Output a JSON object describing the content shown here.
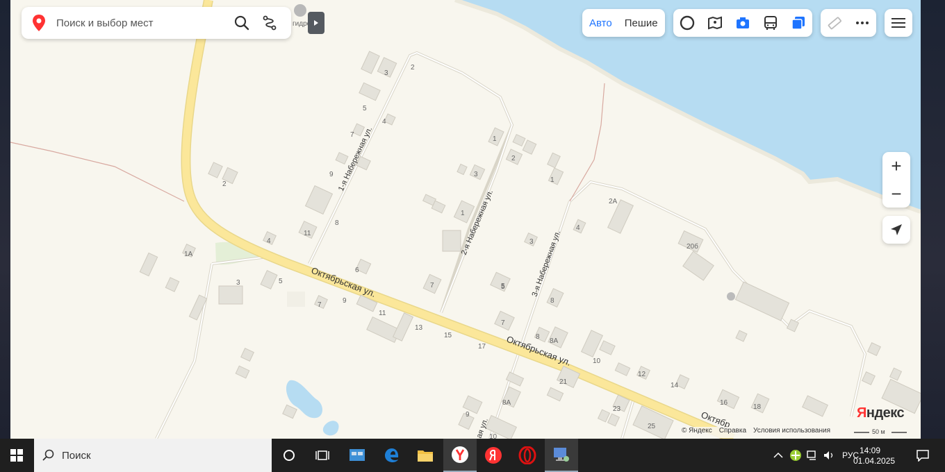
{
  "search": {
    "placeholder": "Поиск и выбор мест"
  },
  "modes": {
    "auto": "Авто",
    "walk": "Пешие"
  },
  "brand": {
    "first": "Я",
    "rest": "ндекс"
  },
  "footer": {
    "copyright": "© Яндекс",
    "help": "Справка",
    "terms": "Условия использования"
  },
  "scale": {
    "label": "50 м"
  },
  "map_labels": {
    "poi": "гидро",
    "street_oct": "Октябрьская ул.",
    "street_oct_2": "Октябрьская ул.",
    "street_oct_edge": "Октябр",
    "street_nab1": "1-я Набережная ул.",
    "street_nab2": "2-я Набережная ул.",
    "street_nab3": "3-я Набережная ул.",
    "street_edge": "ая ул."
  },
  "house_numbers": [
    "3",
    "2",
    "5",
    "4",
    "7",
    "9",
    "2",
    "1",
    "2",
    "3",
    "1",
    "2А",
    "1",
    "4",
    "8",
    "11",
    "4",
    "1А",
    "6",
    "5",
    "3",
    "5",
    "3",
    "20б",
    "7",
    "9",
    "11",
    "7",
    "8",
    "5",
    "13",
    "15",
    "17",
    "7",
    "8",
    "8А",
    "10",
    "21",
    "12",
    "14",
    "8А",
    "23",
    "16",
    "18",
    "9",
    "25",
    "10"
  ],
  "taskbar": {
    "search_text": "Поиск",
    "lang": "РУС",
    "time": "14:09",
    "date": "01.04.2025"
  },
  "colors": {
    "water": "#b6dcf2",
    "land": "#f8f6ee",
    "road_main": "#fbe79a",
    "accent": "#1e74ff",
    "pin": "#f33"
  }
}
